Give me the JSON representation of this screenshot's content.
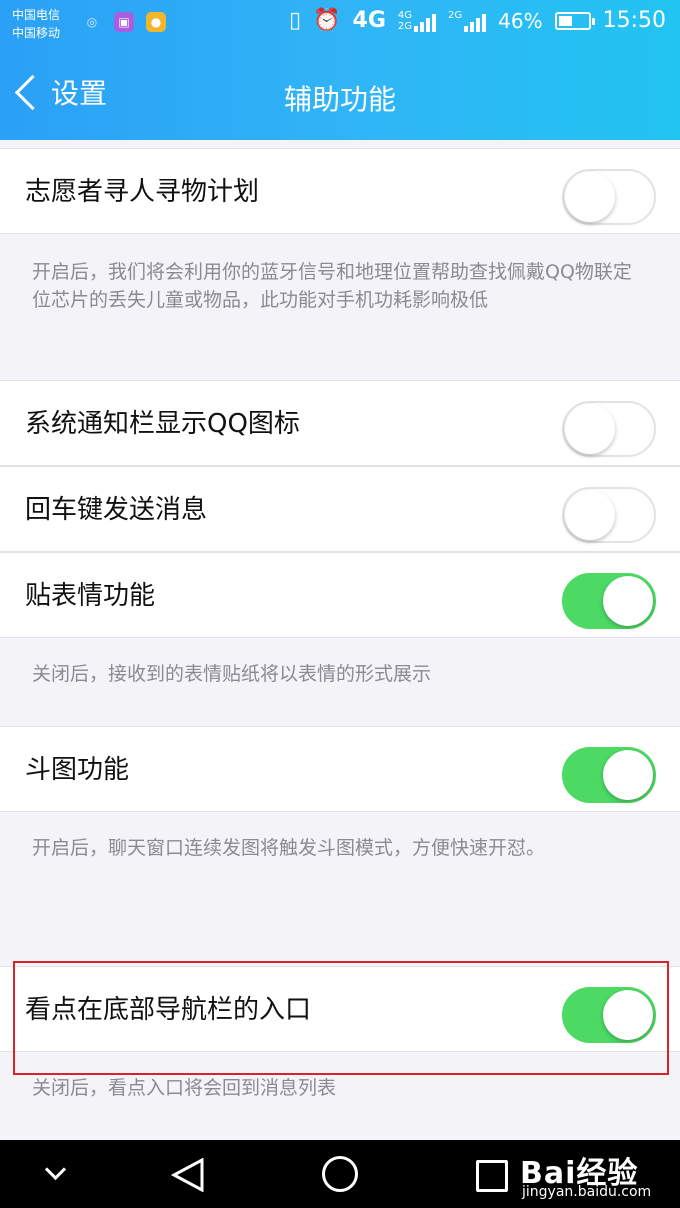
{
  "status_bar": {
    "carrier1": "中国电信",
    "carrier2": "中国移动",
    "network": "4G",
    "network_small1": "4G",
    "network_small2": "2G",
    "network_small3": "2G",
    "battery_pct": "46%",
    "battery_level": 0.46,
    "time": "15:50"
  },
  "header": {
    "back_label": "设置",
    "title": "辅助功能"
  },
  "settings": [
    {
      "label": "志愿者寻人寻物计划",
      "on": false,
      "desc": "开启后，我们将会利用你的蓝牙信号和地理位置帮助查找佩戴QQ物联定位芯片的丢失儿童或物品，此功能对手机功耗影响极低"
    },
    {
      "label": "系统通知栏显示QQ图标",
      "on": false
    },
    {
      "label": "回车键发送消息",
      "on": false
    },
    {
      "label": "贴表情功能",
      "on": true,
      "desc": "关闭后，接收到的表情贴纸将以表情的形式展示"
    },
    {
      "label": "斗图功能",
      "on": true,
      "desc": "开启后，聊天窗口连续发图将触发斗图模式，方便快速开怼。"
    },
    {
      "label": "看点在底部导航栏的入口",
      "on": true,
      "desc": "关闭后，看点入口将会回到消息列表"
    }
  ],
  "watermark": {
    "brand": "Bai经验",
    "url": "jingyan.baidu.com"
  },
  "colors": {
    "header_start": "#2aa0f6",
    "header_end": "#22c4f2",
    "switch_on": "#4cd964",
    "highlight": "#d6242a"
  }
}
